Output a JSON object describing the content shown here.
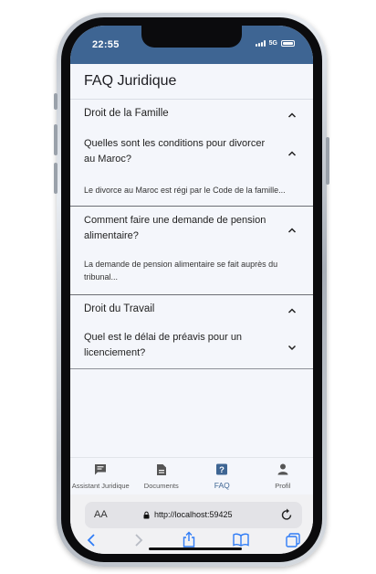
{
  "status_bar": {
    "time": "22:55",
    "network": "5G"
  },
  "header": {
    "title": "FAQ Juridique"
  },
  "faq": [
    {
      "category": "Droit de la Famille",
      "questions": [
        {
          "question": "Quelles sont les conditions pour divorcer au Maroc?",
          "answer": "Le divorce au Maroc est régi par le Code de la famille..."
        },
        {
          "question": "Comment faire une demande de pension alimentaire?",
          "answer": "La demande de pension alimentaire se fait auprès du tribunal..."
        }
      ]
    },
    {
      "category": "Droit du Travail",
      "questions": [
        {
          "question": "Quel est le délai de préavis pour un licenciement?"
        }
      ]
    }
  ],
  "bottom_nav": {
    "items": [
      {
        "label": "Assistant Juridique",
        "icon": "chat-icon"
      },
      {
        "label": "Documents",
        "icon": "document-icon"
      },
      {
        "label": "FAQ",
        "icon": "help-icon"
      },
      {
        "label": "Profil",
        "icon": "person-icon"
      }
    ],
    "active": "FAQ"
  },
  "browser": {
    "aa": "AA",
    "url": "http://localhost:59425"
  },
  "colors": {
    "primary": "#3e6593",
    "background": "#f4f6fb"
  }
}
